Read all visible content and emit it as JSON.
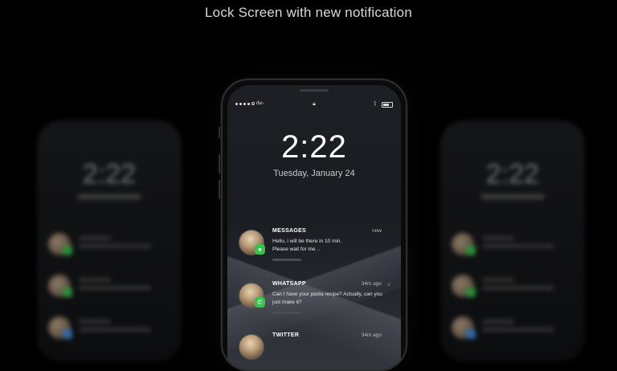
{
  "headline": "Lock Screen with new notification",
  "side_phone_time": "2:22",
  "status": {
    "carrier": "du"
  },
  "time": "2:22",
  "date": "Tuesday, January 24",
  "notifications": [
    {
      "app": "MESSAGES",
      "when": "now",
      "message": "Hello, i will be there in 10 min.\nPlease wait for me ..",
      "icon": "message-bubble-icon"
    },
    {
      "app": "WHATSAPP",
      "when": "34m ago",
      "message": "Can I have your pasta recipe? Actually, can you just make it?",
      "icon": "whatsapp-phone-icon"
    },
    {
      "app": "TWITTER",
      "when": "34m ago",
      "message": "",
      "icon": "twitter-bird-icon"
    }
  ],
  "colors": {
    "badge_green": "#37c24b",
    "background": "#000000"
  }
}
